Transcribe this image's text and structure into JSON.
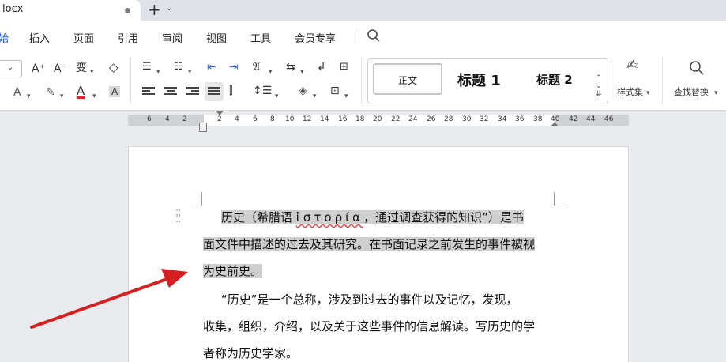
{
  "tab": {
    "label": "locx"
  },
  "menu": {
    "items": [
      "始",
      "插入",
      "页面",
      "引用",
      "审阅",
      "视图",
      "工具",
      "会员专享"
    ]
  },
  "ribbon": {
    "font_grow": "A⁺",
    "font_shrink": "A⁻",
    "phonetic": "变",
    "clear_format": "◇",
    "font_color_letter": "A",
    "char_shade": "A",
    "styles": {
      "normal": "正文",
      "heading1": "标题 1",
      "heading2": "标题 2"
    },
    "style_set_label": "样式集",
    "find_replace_label": "查找替换"
  },
  "ruler": {
    "ticks": [
      "6",
      "4",
      "2",
      "2",
      "4",
      "6",
      "8",
      "10",
      "12",
      "14",
      "16",
      "18",
      "20",
      "22",
      "24",
      "26",
      "28",
      "30",
      "32",
      "34",
      "36",
      "38",
      "40",
      "42",
      "44",
      "46"
    ]
  },
  "document": {
    "para1": {
      "line1_pre": "历史（希腊语 ",
      "line1_greek": "ἱστορία",
      "line1_post": "，通过调查获得的知识”）是书",
      "line2": "面文件中描述的过去及其研究。在书面记录之前发生的事件被视",
      "line3": "为史前史。"
    },
    "para2": {
      "line1": "“历史”是一个总称，涉及到过去的事件以及记忆，发现，",
      "line2": "收集，组织，介绍，以及关于这些事件的信息解读。写历史的学",
      "line3": "者称为历史学家。"
    }
  },
  "colors": {
    "accent": "#1f5fd6",
    "arrow": "#d42020",
    "selection": "#cfcfcf"
  }
}
